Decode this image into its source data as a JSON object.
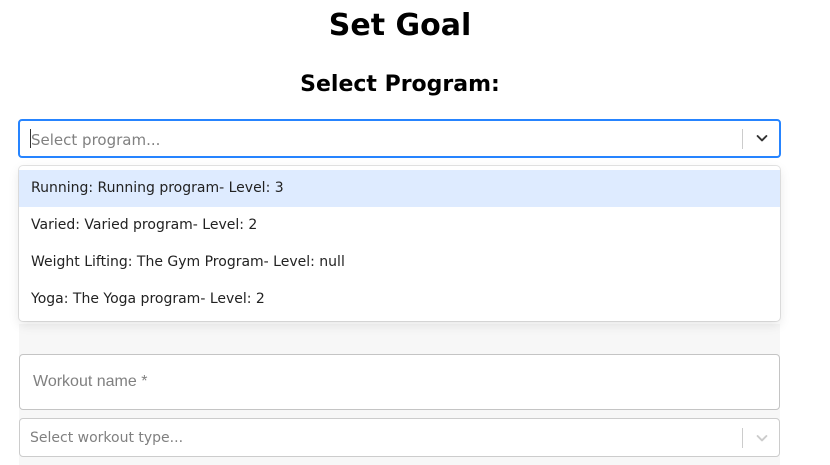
{
  "page": {
    "title": "Set Goal",
    "section_title": "Select Program:"
  },
  "program_select": {
    "placeholder": "Select program...",
    "options": [
      "Running: Running program- Level: 3",
      "Varied: Varied program- Level: 2",
      "Weight Lifting: The Gym Program- Level: null",
      "Yoga: The Yoga program- Level: 2"
    ],
    "focused_index": 0
  },
  "workout_name": {
    "label": "Workout name *"
  },
  "workout_type_select": {
    "placeholder": "Select workout type..."
  },
  "colors": {
    "focus_border": "#2684ff",
    "option_highlight": "#deebff"
  },
  "icons": {
    "dropdown": "chevron-down-icon"
  }
}
